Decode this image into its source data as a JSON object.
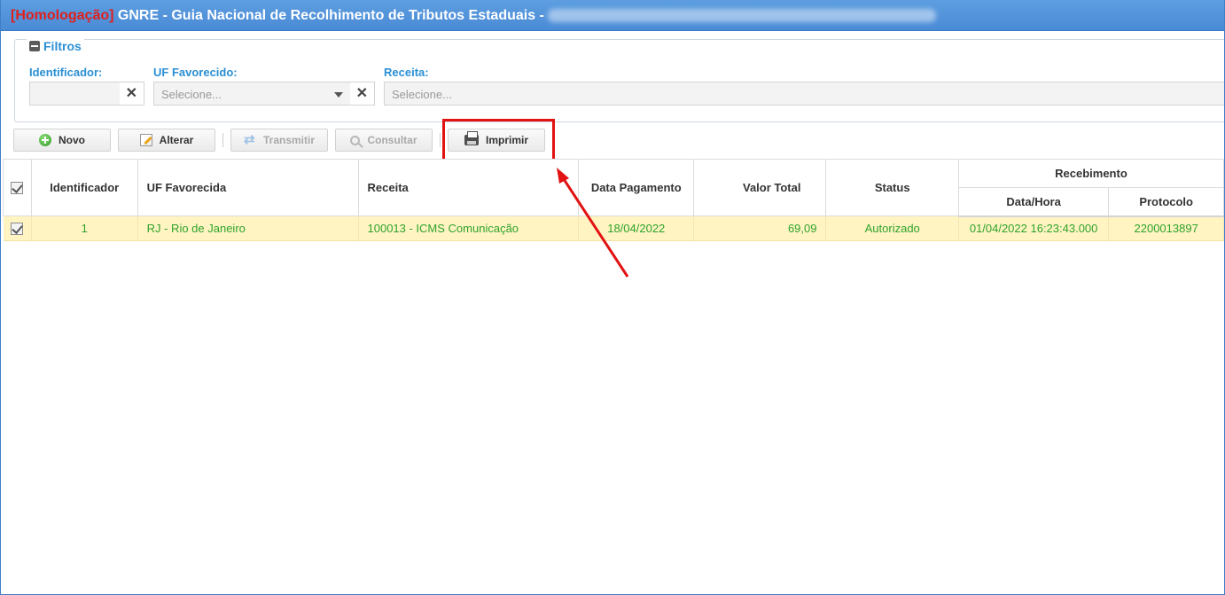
{
  "title": {
    "env": "[Homologação]",
    "text": "GNRE - Guia Nacional de Recolhimento de Tributos Estaduais -"
  },
  "filters": {
    "legend": "Filtros",
    "identificador_label": "Identificador:",
    "uf_label": "UF Favorecido:",
    "uf_placeholder": "Selecione...",
    "receita_label": "Receita:",
    "receita_placeholder": "Selecione..."
  },
  "toolbar": {
    "novo": "Novo",
    "alterar": "Alterar",
    "transmitir": "Transmitir",
    "consultar": "Consultar",
    "imprimir": "Imprimir"
  },
  "table": {
    "headers": {
      "identificador": "Identificador",
      "uf": "UF Favorecida",
      "receita": "Receita",
      "data_pagamento": "Data Pagamento",
      "valor_total": "Valor Total",
      "status": "Status",
      "recebimento": "Recebimento",
      "data_hora": "Data/Hora",
      "protocolo": "Protocolo"
    },
    "rows": [
      {
        "identificador": "1",
        "uf": "RJ - Rio de Janeiro",
        "receita": "100013 - ICMS Comunicação",
        "data_pagamento": "18/04/2022",
        "valor_total": "69,09",
        "status": "Autorizado",
        "data_hora": "01/04/2022 16:23:43.000",
        "protocolo": "2200013897"
      }
    ]
  },
  "colors": {
    "accent": "#2a8fd4",
    "title_bar": "#4a8bd6",
    "env_red": "#e0211d",
    "row_highlight": "#fff4c2",
    "row_text": "#2fa32c",
    "annotation": "#e21212"
  }
}
